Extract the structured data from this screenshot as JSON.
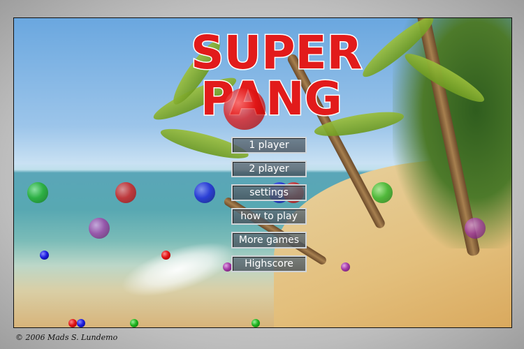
{
  "logo": {
    "line1": "SUPER",
    "line2": "PANG"
  },
  "menu": {
    "items": [
      "1 player",
      "2 player",
      "settings",
      "how to play",
      "More games",
      "Highscore"
    ]
  },
  "balls": [
    {
      "color": "green",
      "size": "large"
    },
    {
      "color": "red",
      "size": "large"
    },
    {
      "color": "blue",
      "size": "large"
    },
    {
      "color": "blue",
      "size": "large"
    },
    {
      "color": "red",
      "size": "large"
    },
    {
      "color": "green",
      "size": "large"
    },
    {
      "color": "purple",
      "size": "large"
    },
    {
      "color": "purple",
      "size": "large"
    },
    {
      "color": "red",
      "size": "huge"
    },
    {
      "color": "blue",
      "size": "small"
    },
    {
      "color": "red",
      "size": "small"
    },
    {
      "color": "purple",
      "size": "small"
    },
    {
      "color": "purple",
      "size": "small"
    },
    {
      "color": "red",
      "size": "small"
    },
    {
      "color": "blue",
      "size": "small"
    },
    {
      "color": "green",
      "size": "small"
    },
    {
      "color": "green",
      "size": "small"
    }
  ],
  "colors": {
    "logo_red": "#e21b1b",
    "button_gray": "#5f6e78"
  },
  "footer": {
    "copyright": "© 2006 Mads S. Lundemo"
  }
}
